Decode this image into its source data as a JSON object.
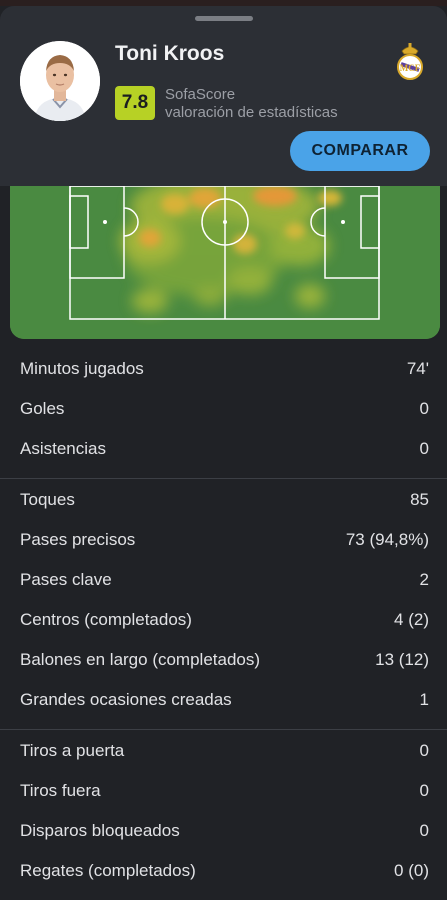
{
  "player": {
    "name": "Toni Kroos",
    "rating": "7.8",
    "rating_source_line1": "SofaScore",
    "rating_source_line2": "valoración de estadísticas",
    "compare_label": "COMPARAR"
  },
  "colors": {
    "background": "#202226",
    "header": "#2c2f35",
    "rating_badge": "#b7d125",
    "compare_button": "#4aa3e8",
    "pitch": "#4a8a41"
  },
  "stats": {
    "group1": [
      {
        "label": "Minutos jugados",
        "value": "74'"
      },
      {
        "label": "Goles",
        "value": "0"
      },
      {
        "label": "Asistencias",
        "value": "0"
      }
    ],
    "group2": [
      {
        "label": "Toques",
        "value": "85"
      },
      {
        "label": "Pases precisos",
        "value": "73 (94,8%)"
      },
      {
        "label": "Pases clave",
        "value": "2"
      },
      {
        "label": "Centros (completados)",
        "value": "4 (2)"
      },
      {
        "label": "Balones en largo (completados)",
        "value": "13 (12)"
      },
      {
        "label": "Grandes ocasiones creadas",
        "value": "1"
      }
    ],
    "group3": [
      {
        "label": "Tiros a puerta",
        "value": "0"
      },
      {
        "label": "Tiros fuera",
        "value": "0"
      },
      {
        "label": "Disparos bloqueados",
        "value": "0"
      },
      {
        "label": "Regates (completados)",
        "value": "0 (0)"
      }
    ]
  }
}
